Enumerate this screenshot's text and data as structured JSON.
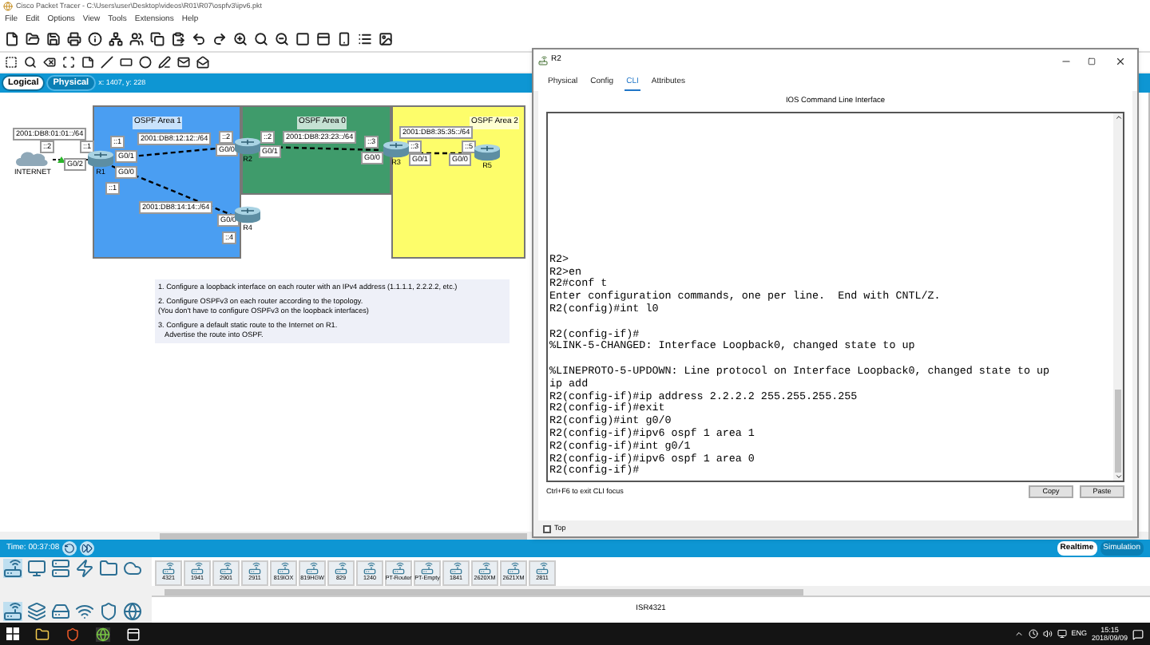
{
  "app": {
    "title": "Cisco Packet Tracer - C:\\Users\\user\\Desktop\\videos\\R01\\R07\\ospfv3\\ipv6.pkt",
    "menu": [
      "File",
      "Edit",
      "Options",
      "View",
      "Tools",
      "Extensions",
      "Help"
    ]
  },
  "workspace_tabs": [
    {
      "label": "Logical",
      "selected": true
    },
    {
      "label": "Physical",
      "selected": false
    }
  ],
  "coordinates": "x: 1407, y: 228",
  "topology": {
    "areas": [
      {
        "label": "OSPF Area 1",
        "color": "#4a9ef2"
      },
      {
        "label": "OSPF Area 0",
        "color": "#3f9b6b"
      },
      {
        "label": "OSPF Area 2",
        "color": "#fdfd6a"
      }
    ],
    "tags": [
      "2001:DB8:01:01::/64",
      "::2",
      "::1",
      "G0/2",
      "::1",
      "2001:DB8:12:12::/64",
      "::2",
      "G0/1",
      "G0/0",
      "G0/0",
      "::1",
      "2001:DB8:14:14::/64",
      "G0/0",
      "::4",
      "::2",
      "2001:DB8:23:23::/64",
      "::3",
      "G0/1",
      "G0/0",
      "::3",
      "G0/1",
      "::5",
      "G0/0",
      "2001:DB8:35:35::/64"
    ],
    "devices": [
      {
        "name": "INTERNET",
        "kind": "cloud"
      },
      {
        "name": "R1",
        "kind": "router"
      },
      {
        "name": "R2",
        "kind": "router"
      },
      {
        "name": "R4",
        "kind": "router"
      },
      {
        "name": "R3",
        "kind": "router"
      },
      {
        "name": "R5",
        "kind": "router"
      }
    ]
  },
  "instructions": [
    [
      "1. Configure a loopback interface on each router with an IPv4 address (1.1.1.1, 2.2.2.2, etc.)"
    ],
    [
      "2. Configure OSPFv3 on each router according to the topology.",
      "(You don't have to configure OSPFv3 on the loopback interfaces)"
    ],
    [
      "3. Configure a default static route to the Internet on R1.",
      "Advertise the route into OSPF."
    ]
  ],
  "status_bar": {
    "time": "Time: 00:37:08",
    "modes": [
      {
        "label": "Realtime",
        "selected": true
      },
      {
        "label": "Simulation",
        "selected": false
      }
    ]
  },
  "device_list": {
    "items": [
      "4321",
      "1941",
      "2901",
      "2911",
      "819IOX",
      "819HGW",
      "829",
      "1240",
      "PT-Router",
      "PT-Empty",
      "1841",
      "2620XM",
      "2621XM",
      "2811"
    ],
    "selected_model": "ISR4321"
  },
  "taskbar": {
    "language": "ENG",
    "time": "15:15",
    "date": "2018/09/09"
  },
  "dialog": {
    "title": "R2",
    "tabs": [
      {
        "label": "Physical",
        "selected": false
      },
      {
        "label": "Config",
        "selected": false
      },
      {
        "label": "CLI",
        "selected": true
      },
      {
        "label": "Attributes",
        "selected": false
      }
    ],
    "header": "IOS Command Line Interface",
    "terminal_blocks": [
      [
        "R2>",
        "R2>en",
        "R2#conf t",
        "Enter configuration commands, one per line.  End with CNTL/Z.",
        "R2(config)#int l0"
      ],
      [
        "R2(config-if)#",
        "%LINK-5-CHANGED: Interface Loopback0, changed state to up"
      ],
      [
        "%LINEPROTO-5-UPDOWN: Line protocol on Interface Loopback0, changed state to up",
        "ip add",
        "R2(config-if)#ip address 2.2.2.2 255.255.255.255",
        "R2(config-if)#exit",
        "R2(config)#int g0/0",
        "R2(config-if)#ipv6 ospf 1 area 1",
        "R2(config-if)#int g0/1",
        "R2(config-if)#ipv6 ospf 1 area 0",
        "R2(config-if)#"
      ]
    ],
    "hint": "Ctrl+F6 to exit CLI focus",
    "buttons": [
      "Copy",
      "Paste"
    ],
    "top_checkbox": {
      "label": "Top",
      "checked": false
    }
  }
}
